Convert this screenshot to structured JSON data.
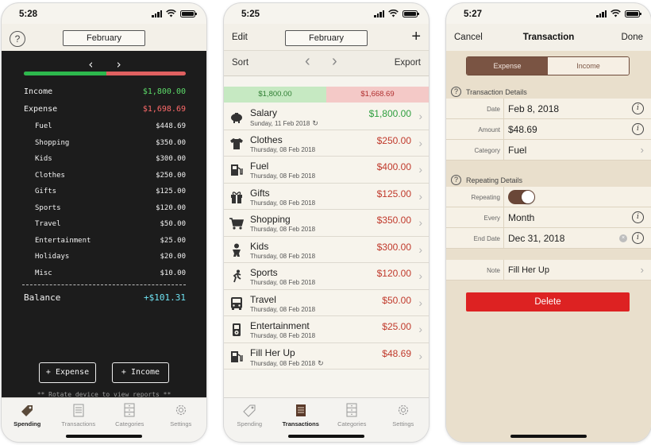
{
  "phone1": {
    "time": "5:28",
    "help_icon": "?",
    "month": "February",
    "prev_chevron": "‹",
    "next_chevron": "›",
    "income_fraction": 0.51,
    "income_label": "Income",
    "income_value": "$1,800.00",
    "expense_label": "Expense",
    "expense_value": "$1,698.69",
    "categories": [
      {
        "name": "Fuel",
        "value": "$448.69"
      },
      {
        "name": "Shopping",
        "value": "$350.00"
      },
      {
        "name": "Kids",
        "value": "$300.00"
      },
      {
        "name": "Clothes",
        "value": "$250.00"
      },
      {
        "name": "Gifts",
        "value": "$125.00"
      },
      {
        "name": "Sports",
        "value": "$120.00"
      },
      {
        "name": "Travel",
        "value": "$50.00"
      },
      {
        "name": "Entertainment",
        "value": "$25.00"
      },
      {
        "name": "Holidays",
        "value": "$20.00"
      },
      {
        "name": "Misc",
        "value": "$10.00"
      }
    ],
    "balance_label": "Balance",
    "balance_value": "+$101.31",
    "add_expense": "+ Expense",
    "add_income": "+ Income",
    "hint": "** Rotate device to view reports **",
    "tabs": [
      "Spending",
      "Transactions",
      "Categories",
      "Settings"
    ]
  },
  "phone2": {
    "time": "5:25",
    "edit": "Edit",
    "month": "February",
    "plus": "+",
    "sort": "Sort",
    "export": "Export",
    "prev_arrow": "‹",
    "next_arrow": "›",
    "income_total": "$1,800.00",
    "expense_total": "$1,668.69",
    "chevron": "›",
    "repeat_glyph": "↻",
    "transactions": [
      {
        "name": "Salary",
        "date": "Sunday, 11 Feb 2018",
        "amount": "$1,800.00",
        "income": true,
        "repeat": true,
        "icon": "piggy-bank-icon"
      },
      {
        "name": "Clothes",
        "date": "Thursday, 08 Feb 2018",
        "amount": "$250.00",
        "icon": "t-shirt-icon"
      },
      {
        "name": "Fuel",
        "date": "Thursday, 08 Feb 2018",
        "amount": "$400.00",
        "icon": "fuel-pump-icon"
      },
      {
        "name": "Gifts",
        "date": "Thursday, 08 Feb 2018",
        "amount": "$125.00",
        "icon": "gift-icon"
      },
      {
        "name": "Shopping",
        "date": "Thursday, 08 Feb 2018",
        "amount": "$350.00",
        "icon": "shopping-cart-icon"
      },
      {
        "name": "Kids",
        "date": "Thursday, 08 Feb 2018",
        "amount": "$300.00",
        "icon": "baby-icon"
      },
      {
        "name": "Sports",
        "date": "Thursday, 08 Feb 2018",
        "amount": "$120.00",
        "icon": "runner-icon"
      },
      {
        "name": "Travel",
        "date": "Thursday, 08 Feb 2018",
        "amount": "$50.00",
        "icon": "bus-icon"
      },
      {
        "name": "Entertainment",
        "date": "Thursday, 08 Feb 2018",
        "amount": "$25.00",
        "icon": "ipod-icon"
      },
      {
        "name": "Fill Her Up",
        "date": "Thursday, 08 Feb 2018",
        "amount": "$48.69",
        "repeat": true,
        "icon": "fuel-pump-icon"
      }
    ],
    "tabs": [
      "Spending",
      "Transactions",
      "Categories",
      "Settings"
    ]
  },
  "phone3": {
    "time": "5:27",
    "cancel": "Cancel",
    "title": "Transaction",
    "done": "Done",
    "seg_expense": "Expense",
    "seg_income": "Income",
    "section_details": "Transaction Details",
    "section_repeating": "Repeating Details",
    "help_glyph": "?",
    "info_glyph": "i",
    "clear_glyph": "×",
    "chevron": "›",
    "date_label": "Date",
    "date_value": "Feb 8, 2018",
    "amount_label": "Amount",
    "amount_value": "$48.69",
    "category_label": "Category",
    "category_value": "Fuel",
    "repeating_label": "Repeating",
    "every_label": "Every",
    "every_value": "Month",
    "end_label": "End Date",
    "end_value": "Dec 31, 2018",
    "note_label": "Note",
    "note_value": "Fill Her Up",
    "delete": "Delete"
  },
  "colors": {
    "income": "#2e9e3e",
    "expense": "#c0392b",
    "accent_brown": "#7a5443",
    "delete_red": "#dd2222"
  }
}
